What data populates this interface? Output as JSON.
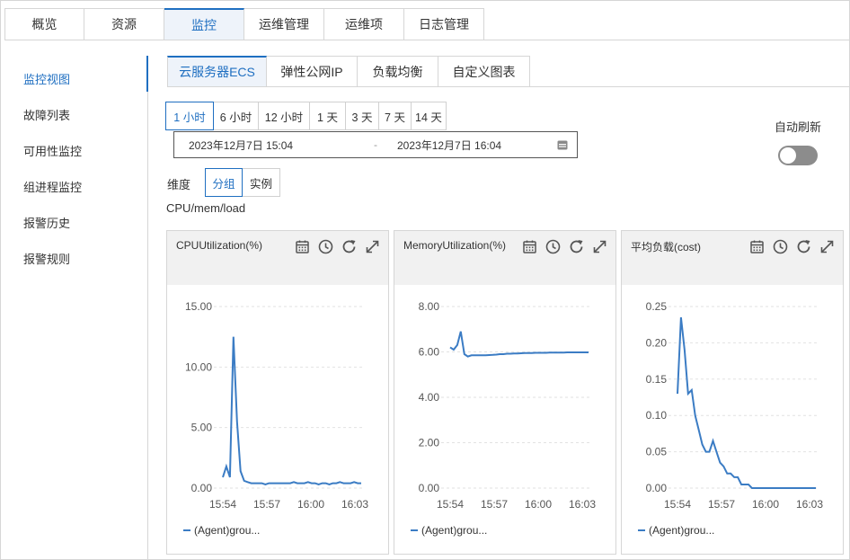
{
  "top_tabs": [
    {
      "label": "概览",
      "width": 89
    },
    {
      "label": "资源",
      "width": 89
    },
    {
      "label": "监控",
      "width": 89,
      "active": true
    },
    {
      "label": "运维管理",
      "width": 89
    },
    {
      "label": "运维项",
      "width": 89
    },
    {
      "label": "日志管理",
      "width": 89
    }
  ],
  "sidebar": {
    "items": [
      {
        "label": "监控视图",
        "active": true
      },
      {
        "label": "故障列表"
      },
      {
        "label": "可用性监控"
      },
      {
        "label": "组进程监控"
      },
      {
        "label": "报警历史"
      },
      {
        "label": "报警规则"
      }
    ]
  },
  "sub_tabs": [
    {
      "label": "云服务器ECS",
      "active": true
    },
    {
      "label": "弹性公网IP"
    },
    {
      "label": "负载均衡"
    },
    {
      "label": "自定义图表"
    }
  ],
  "time_ranges": [
    "1 小时",
    "6 小时",
    "12 小时",
    "1 天",
    "3 天",
    "7 天",
    "14 天"
  ],
  "date_range": {
    "start": "2023年12月7日 15:04",
    "separator": "-",
    "end": "2023年12月7日 16:04"
  },
  "auto_refresh": {
    "label": "自动刷新",
    "on": false
  },
  "dimension": {
    "label": "维度",
    "options": [
      "分组",
      "实例"
    ],
    "selected": "分组"
  },
  "metric_group": "CPU/mem/load",
  "line_color": "#3b7cc4",
  "accent_color": "#1f6fc1",
  "icons": [
    "calendar-icon",
    "clock-icon",
    "refresh-icon",
    "expand-icon"
  ],
  "charts": [
    {
      "title": "CPUUtilization(%)",
      "legend": "(Agent)grou...",
      "chart_data": {
        "type": "line",
        "ylim": [
          0,
          15
        ],
        "yticks": [
          "15.00",
          "10.00",
          "5.00",
          "0.00"
        ],
        "xticks": [
          "15:54",
          "15:57",
          "16:00",
          "16:03"
        ],
        "series": [
          {
            "name": "(Agent)grou...",
            "values": [
              0.9,
              1.8,
              0.9,
              12.5,
              5.5,
              1.4,
              0.6,
              0.5,
              0.4,
              0.4,
              0.4,
              0.4,
              0.3,
              0.4,
              0.4,
              0.4,
              0.4,
              0.4,
              0.4,
              0.4,
              0.5,
              0.4,
              0.4,
              0.4,
              0.5,
              0.4,
              0.4,
              0.3,
              0.4,
              0.4,
              0.3,
              0.4,
              0.4,
              0.5,
              0.4,
              0.4,
              0.4,
              0.5,
              0.4,
              0.4
            ]
          }
        ]
      }
    },
    {
      "title": "MemoryUtilization(%)",
      "legend": "(Agent)grou...",
      "chart_data": {
        "type": "line",
        "ylim": [
          0,
          8
        ],
        "yticks": [
          "8.00",
          "6.00",
          "4.00",
          "2.00",
          "0.00"
        ],
        "xticks": [
          "15:54",
          "15:57",
          "16:00",
          "16:03"
        ],
        "series": [
          {
            "name": "(Agent)grou...",
            "values": [
              6.2,
              6.1,
              6.3,
              6.9,
              5.9,
              5.8,
              5.85,
              5.85,
              5.85,
              5.85,
              5.85,
              5.86,
              5.87,
              5.88,
              5.9,
              5.9,
              5.92,
              5.92,
              5.93,
              5.93,
              5.94,
              5.95,
              5.95,
              5.95,
              5.96,
              5.96,
              5.96,
              5.96,
              5.97,
              5.97,
              5.97,
              5.97,
              5.97,
              5.98,
              5.98,
              5.98,
              5.98,
              5.98,
              5.98,
              5.98
            ]
          }
        ]
      }
    },
    {
      "title": "平均负载(cost)",
      "legend": "(Agent)grou...",
      "chart_data": {
        "type": "line",
        "ylim": [
          0,
          0.25
        ],
        "yticks": [
          "0.25",
          "0.20",
          "0.15",
          "0.10",
          "0.05",
          "0.00"
        ],
        "xticks": [
          "15:54",
          "15:57",
          "16:00",
          "16:03"
        ],
        "series": [
          {
            "name": "(Agent)grou...",
            "values": [
              0.13,
              0.235,
              0.19,
              0.13,
              0.135,
              0.1,
              0.08,
              0.06,
              0.05,
              0.05,
              0.065,
              0.05,
              0.035,
              0.03,
              0.02,
              0.02,
              0.015,
              0.015,
              0.005,
              0.005,
              0.005,
              0.0,
              0.0,
              0.0,
              0.0,
              0.0,
              0.0,
              0.0,
              0.0,
              0.0,
              0.0,
              0.0,
              0.0,
              0.0,
              0.0,
              0.0,
              0.0,
              0.0,
              0.0,
              0.0
            ]
          }
        ]
      }
    }
  ]
}
